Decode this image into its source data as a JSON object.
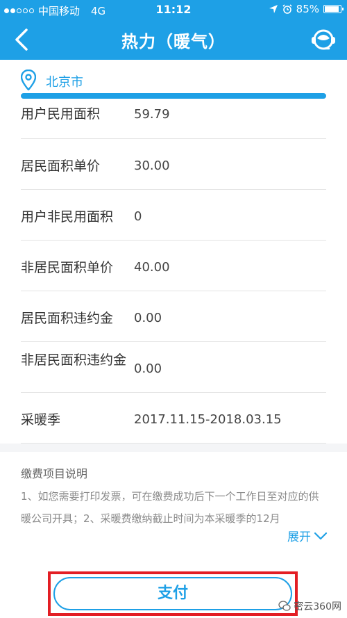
{
  "status_bar": {
    "carrier": "中国移动",
    "network": "4G",
    "time": "11:12",
    "battery_percent": "85%",
    "battery_level": 0.85
  },
  "nav": {
    "title": "热力（暖气）"
  },
  "location": {
    "city": "北京市"
  },
  "rows": [
    {
      "label": "用户民用面积",
      "value": "59.79"
    },
    {
      "label": "居民面积单价",
      "value": "30.00"
    },
    {
      "label": "用户非民用面积",
      "value": "0"
    },
    {
      "label": "非居民面积单价",
      "value": "40.00"
    },
    {
      "label": "居民面积违约金",
      "value": "0.00"
    },
    {
      "label": "非居民面积违约金",
      "value": "0.00"
    },
    {
      "label": "采暖季",
      "value": "2017.11.15-2018.03.15"
    }
  ],
  "notes": {
    "title": "缴费项目说明",
    "text": "1、如您需要打印发票，可在缴费成功后下一个工作日至对应的供暖公司开具；2、采暖费缴纳截止时间为本采暖季的12月",
    "expand_label": "展开"
  },
  "pay": {
    "label": "支付"
  },
  "watermark": "密云360网",
  "colors": {
    "brand": "#1ea0e6",
    "highlight": "#e31e24"
  }
}
